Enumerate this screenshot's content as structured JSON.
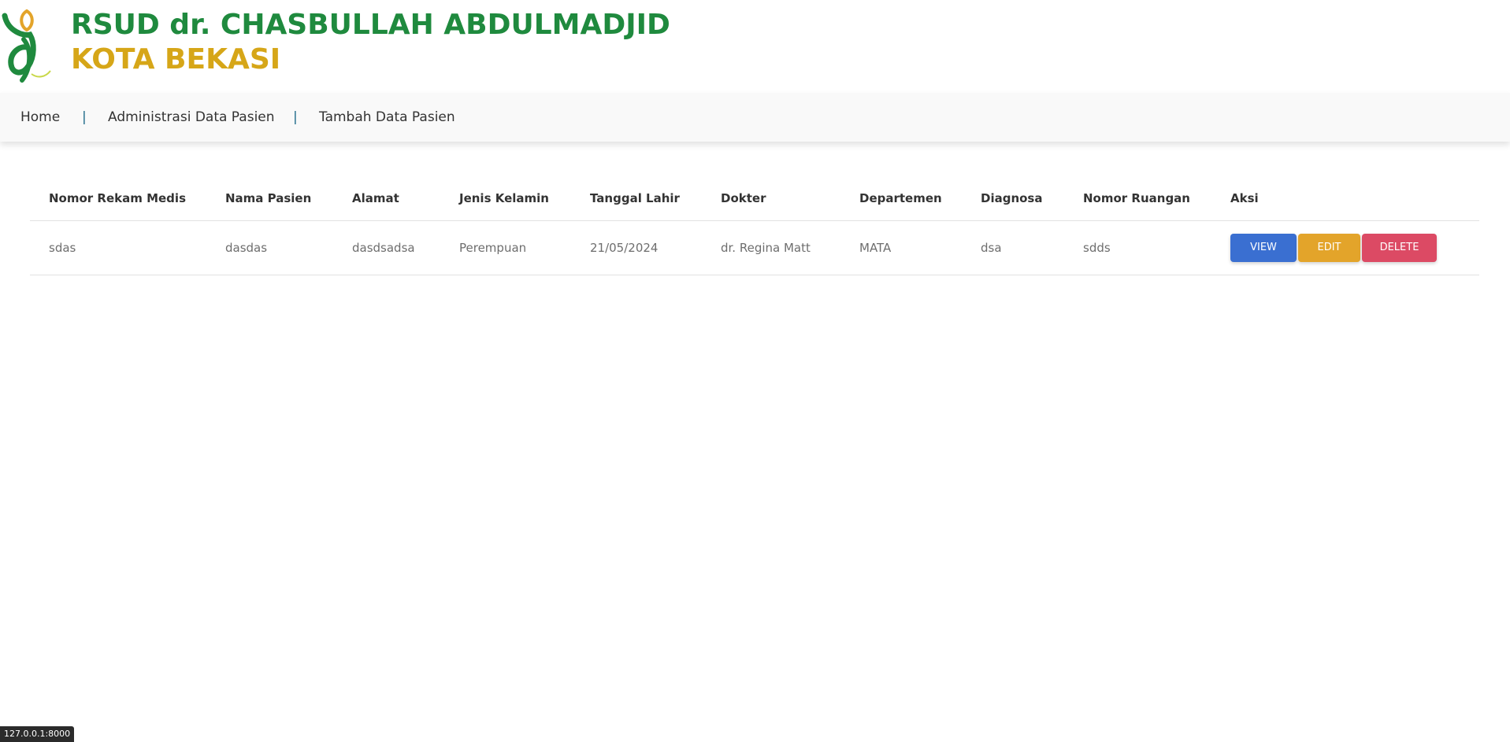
{
  "header": {
    "title_line1": "RSUD dr. CHASBULLAH ABDULMADJID",
    "title_line2": "KOTA BEKASI",
    "logo_icon": "rsud-kota-bekasi-logo",
    "colors": {
      "green": "#1f8a3e",
      "gold": "#d6a618"
    }
  },
  "nav": {
    "items": [
      {
        "label": "Home"
      },
      {
        "label": "Administrasi Data Pasien"
      },
      {
        "label": "Tambah Data Pasien"
      }
    ],
    "separator": "|"
  },
  "table": {
    "columns": [
      "Nomor Rekam Medis",
      "Nama Pasien",
      "Alamat",
      "Jenis Kelamin",
      "Tanggal Lahir",
      "Dokter",
      "Departemen",
      "Diagnosa",
      "Nomor Ruangan",
      "Aksi"
    ],
    "rows": [
      {
        "nomor_rekam_medis": "sdas",
        "nama_pasien": "dasdas",
        "alamat": "dasdsadsa",
        "jenis_kelamin": "Perempuan",
        "tanggal_lahir": "21/05/2024",
        "dokter": "dr. Regina Matt",
        "departemen": "MATA",
        "diagnosa": "dsa",
        "nomor_ruangan": "sdds",
        "actions": {
          "view": "VIEW",
          "edit": "EDIT",
          "delete": "DELETE"
        }
      }
    ],
    "button_colors": {
      "view": "#3a6fd1",
      "edit": "#e3a42a",
      "delete": "#dc4a64"
    }
  },
  "statusbar": {
    "url": "127.0.0.1:8000"
  }
}
